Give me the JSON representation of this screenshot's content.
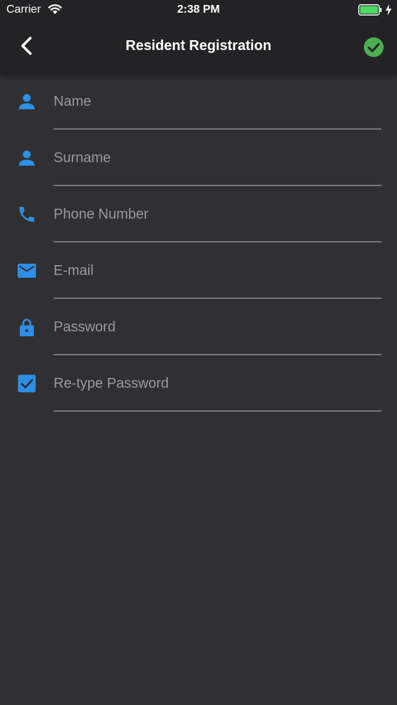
{
  "status_bar": {
    "carrier": "Carrier",
    "time": "2:38 PM"
  },
  "nav": {
    "title": "Resident Registration"
  },
  "colors": {
    "accent_blue": "#2e8fe6",
    "confirm_green": "#4cb050",
    "battery_green": "#4cd964"
  },
  "form": {
    "fields": [
      {
        "icon": "person-icon",
        "placeholder": "Name",
        "value": ""
      },
      {
        "icon": "person-icon",
        "placeholder": "Surname",
        "value": ""
      },
      {
        "icon": "phone-icon",
        "placeholder": "Phone Number",
        "value": ""
      },
      {
        "icon": "mail-icon",
        "placeholder": "E-mail",
        "value": ""
      },
      {
        "icon": "lock-icon",
        "placeholder": "Password",
        "value": ""
      },
      {
        "icon": "checkbox-icon",
        "placeholder": "Re-type Password",
        "value": ""
      }
    ]
  }
}
